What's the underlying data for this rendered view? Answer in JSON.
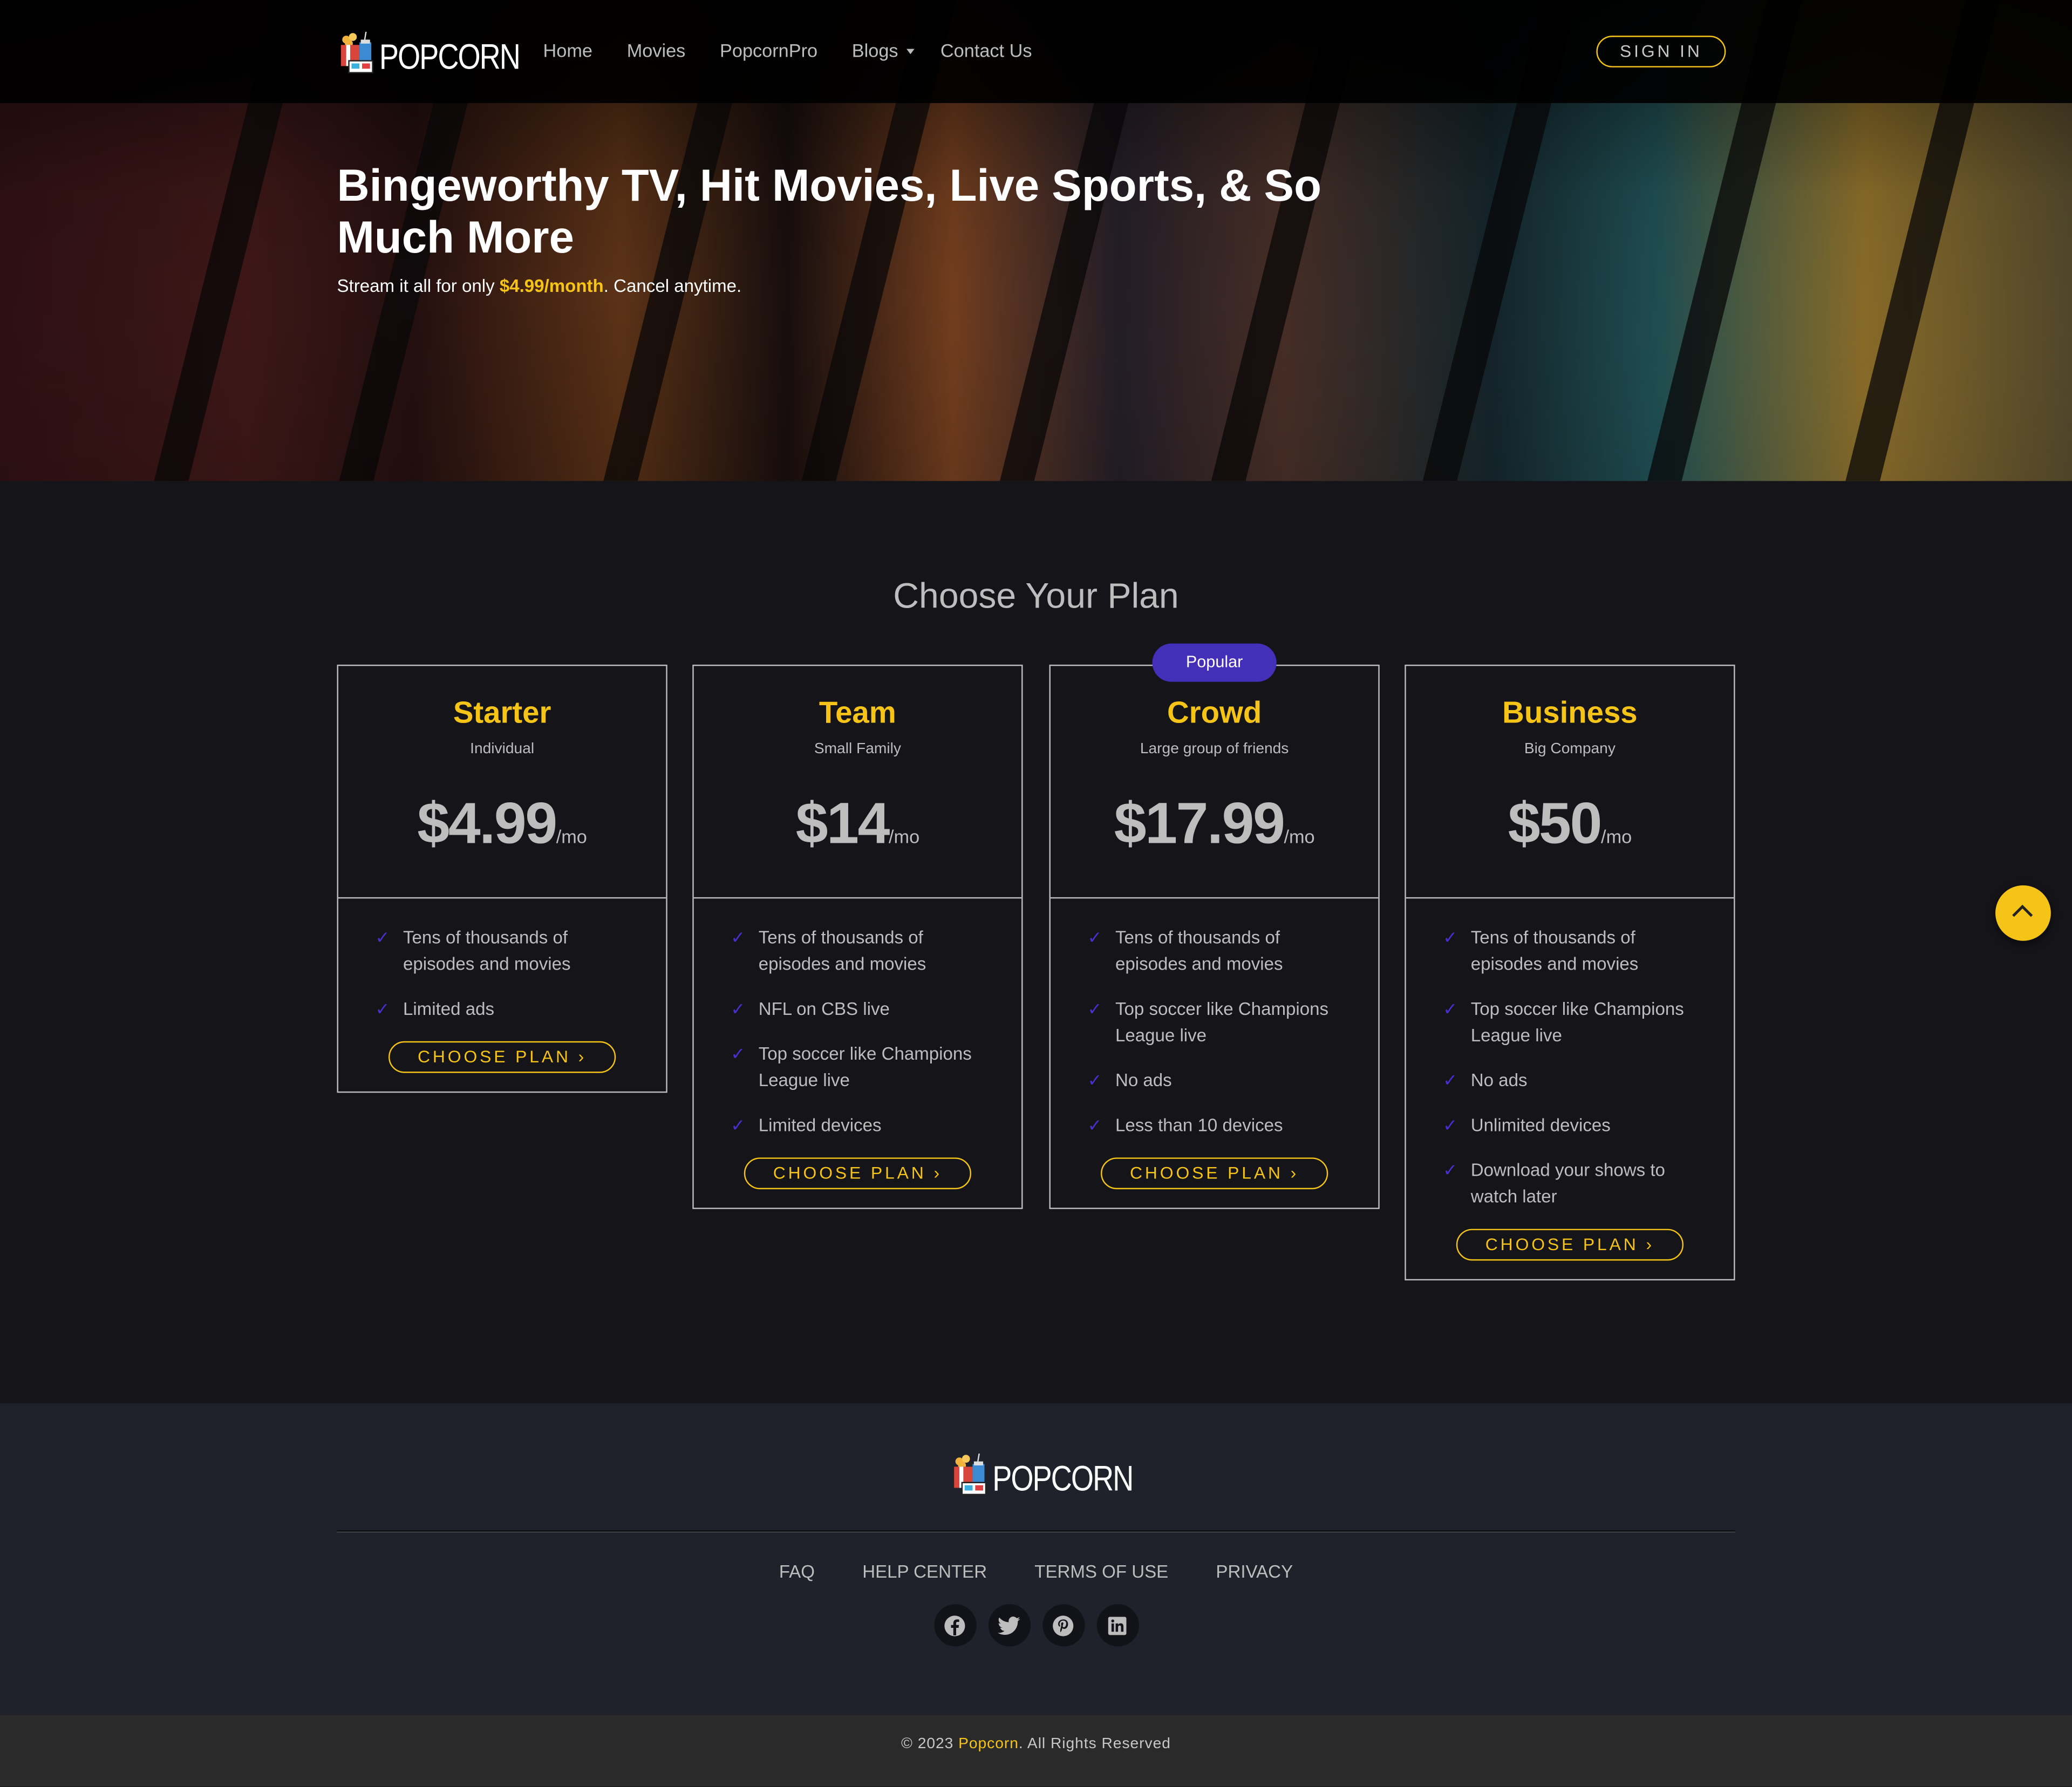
{
  "nav": {
    "logo_text": "POPCORN",
    "links": [
      {
        "label": "Home"
      },
      {
        "label": "Movies"
      },
      {
        "label": "PopcornPro"
      },
      {
        "label": "Blogs",
        "dropdown": true
      },
      {
        "label": "Contact Us"
      }
    ],
    "signin_label": "SIGN IN"
  },
  "hero": {
    "title": "Bingeworthy TV, Hit Movies, Live Sports, & So Much More",
    "subtitle_prefix": "Stream it all for only ",
    "subtitle_highlight": "$4.99/month",
    "subtitle_suffix": ". Cancel anytime."
  },
  "plans": {
    "title": "Choose Your Plan",
    "popular_badge": "Popular",
    "items": [
      {
        "name": "Starter",
        "tagline": "Individual",
        "price": "$4.99",
        "per": "/mo",
        "features": [
          "Tens of thousands of episodes and movies",
          "Limited ads"
        ],
        "cta": "CHOOSE PLAN"
      },
      {
        "name": "Team",
        "tagline": "Small Family",
        "price": "$14",
        "per": "/mo",
        "features": [
          "Tens of thousands of episodes and movies",
          "NFL on CBS live",
          "Top soccer like Champions League live",
          "Limited devices"
        ],
        "cta": "CHOOSE PLAN"
      },
      {
        "name": "Crowd",
        "tagline": "Large group of friends",
        "price": "$17.99",
        "per": "/mo",
        "popular": true,
        "features": [
          "Tens of thousands of episodes and movies",
          "Top soccer like Champions League live",
          "No ads",
          "Less than 10 devices"
        ],
        "cta": "CHOOSE PLAN"
      },
      {
        "name": "Business",
        "tagline": "Big Company",
        "price": "$50",
        "per": "/mo",
        "features": [
          "Tens of thousands of episodes and movies",
          "Top soccer like Champions League live",
          "No ads",
          "Unlimited devices",
          "Download your shows to watch later"
        ],
        "cta": "CHOOSE PLAN"
      }
    ]
  },
  "footer": {
    "logo_text": "POPCORN",
    "links": [
      "FAQ",
      "HELP CENTER",
      "TERMS OF USE",
      "PRIVACY"
    ],
    "social": [
      "facebook",
      "twitter",
      "pinterest",
      "linkedin"
    ],
    "copyright_prefix": "© 2023 ",
    "copyright_brand": "Popcorn",
    "copyright_suffix": ". All Rights Reserved"
  },
  "colors": {
    "accent": "#f6c416",
    "badge": "#432fb8",
    "check": "#4a2fd0",
    "bg": "#141419",
    "footer_bg": "#20222b"
  }
}
